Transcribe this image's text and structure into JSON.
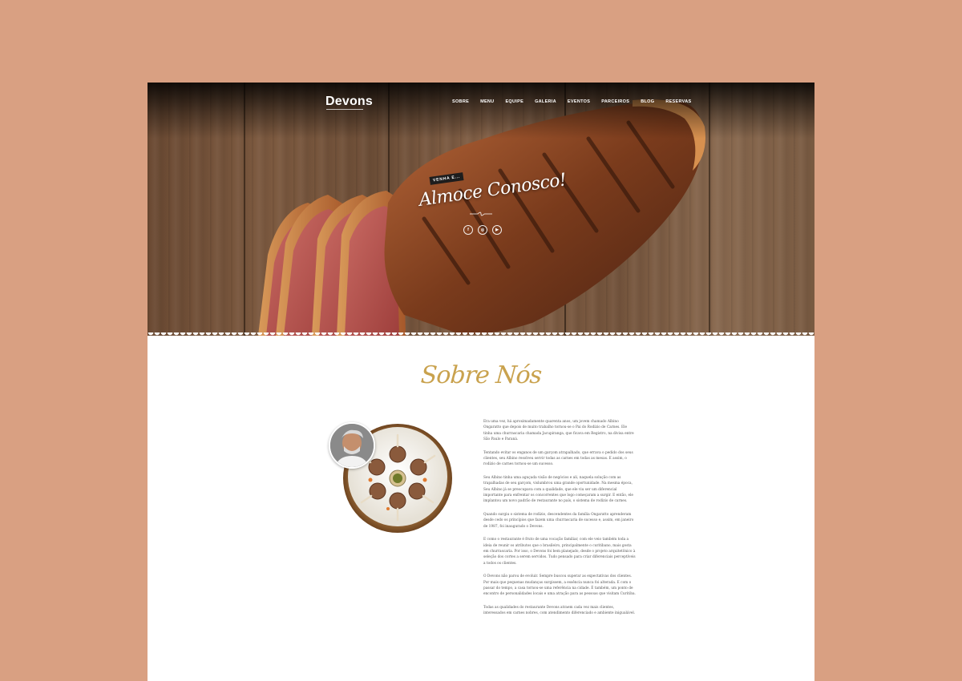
{
  "brand": {
    "logo": "Devons"
  },
  "nav": {
    "items": [
      "SOBRE",
      "MENU",
      "EQUIPE",
      "GALERIA",
      "EVENTOS",
      "PARCEIROS",
      "BLOG",
      "RESERVAS"
    ]
  },
  "hero": {
    "badge": "VENHA E...",
    "title": "Almoce Conosco!",
    "social": [
      {
        "icon": "facebook-icon",
        "glyph": "f"
      },
      {
        "icon": "instagram-icon",
        "glyph": "◎"
      },
      {
        "icon": "youtube-icon",
        "glyph": "▶"
      }
    ]
  },
  "about": {
    "title": "Sobre Nós",
    "paragraphs": [
      "Era uma vez, há aproximadamente quarenta anos, um jovem chamado Albino Ongaratto que depois de muito trabalho tornou-se o Pai do Rodízio de Carnes. Ele tinha uma churrascaria chamada Jacupiranga, que ficava em Registro, na divisa entre São Paulo e Paraná.",
      "Tentando evitar os enganos de um garçom atrapalhado, que errava o pedido dos seus clientes, seu Albino resolveu servir todas as carnes em todas as mesas. E assim, o rodízio de carnes tornou-se um sucesso.",
      "Seu Albino tinha uma aguçada visão de negócios e ali, naquela solução com as trapalhadas de seu garçom, vislumbrou uma grande oportunidade. Na mesma época, Seu Albino já se preocupava com a qualidade, que ele viu ser um diferencial importante para enfrentar os concorrentes que logo começaram a surgir. E então, ele implantou um novo padrão de restaurante no país, o sistema de rodízio de carnes.",
      "Quando surgiu o sistema de rodízio, descendentes da família Ongaratto aprenderam desde cedo os princípios que fazem uma churrascaria de sucesso e, assim, em janeiro de 1987, foi inaugurado o Devons.",
      "E como o restaurante é fruto de uma vocação familiar, com ele veio também toda a ideia de reunir os atributos que o brasileiro, principalmente o curitibano, mais gosta em churrascaria. Por isso, o Devons foi bem planejado, desde o projeto arquitetônico à seleção dos cortes a serem servidos. Tudo pensado para criar diferenciais perceptíveis a todos os clientes.",
      "O Devons não parou de evoluir. Sempre buscou superar as expectativas dos clientes. Por mais que pequenas mudanças surgissem, a essência nunca foi alterada. E com o passar do tempo, a casa tornou-se uma referência na cidade. É também, um ponto de encontro de personalidades locais e uma atração para as pessoas que visitam Curitiba.",
      "Todas as qualidades do restaurante Devons atraem cada vez mais clientes, interessados em carnes nobres, com atendimento diferenciado e ambiente inigualável."
    ]
  },
  "colors": {
    "background": "#d9a082",
    "accent_gold": "#c9a24e",
    "text": "#555555"
  }
}
